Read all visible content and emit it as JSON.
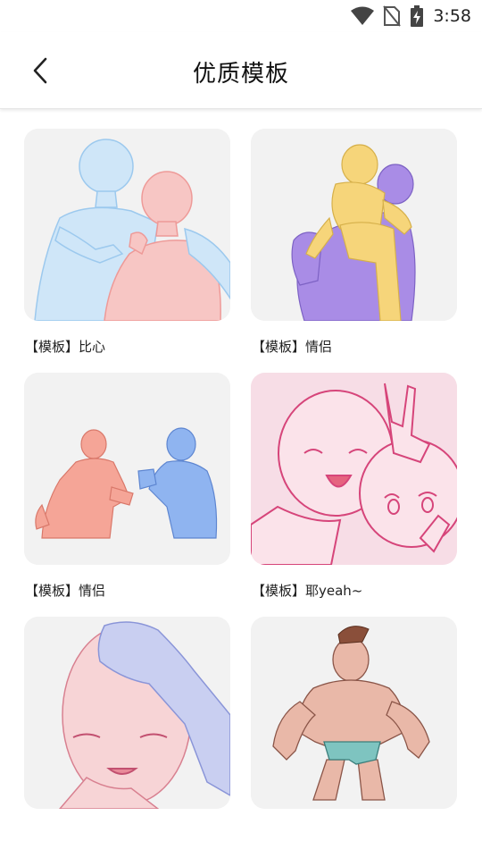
{
  "status": {
    "time": "3:58"
  },
  "header": {
    "title": "优质模板"
  },
  "templates": [
    {
      "label": "【模板】比心"
    },
    {
      "label": "【模板】情侣"
    },
    {
      "label": "【模板】情侣"
    },
    {
      "label": "【模板】耶yeah~"
    },
    {
      "label": ""
    },
    {
      "label": ""
    }
  ],
  "colors": {
    "card_bg": "#f1f1f1",
    "blue_sketch": "#bcdcf4",
    "pink_sketch": "#f7c6c4",
    "yellow_figure": "#f6d57a",
    "purple_figure": "#a98ce6"
  }
}
